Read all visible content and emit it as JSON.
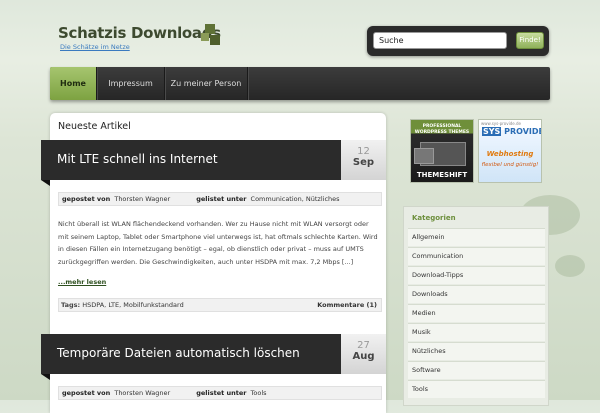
{
  "header": {
    "site_title": "Schatzis Downloads",
    "tagline": "Die Schätze im Netze",
    "search_value": "Suche",
    "search_button": "Finde!"
  },
  "nav": {
    "items": [
      "Home",
      "Impressum",
      "Zu meiner Person"
    ]
  },
  "main": {
    "heading": "Neueste Artikel",
    "posts": [
      {
        "title": "Mit LTE schnell ins Internet",
        "day": "12",
        "month": "Sep",
        "author_label": "gepostet von",
        "author": "Thorsten Wagner",
        "cat_label": "gelistet unter",
        "categories": [
          "Communication",
          "Nützliches"
        ],
        "excerpt": "Nicht überall ist WLAN flächendeckend vorhanden. Wer zu Hause nicht mit WLAN versorgt oder mit seinem Laptop, Tablet oder Smartphone viel unterwegs ist, hat oftmals schlechte Karten. Wird in diesen Fällen ein Internetzugang benötigt – egal, ob dienstlich oder privat – muss auf UMTS zurückgegriffen werden. Die Geschwindigkeiten, auch unter HSDPA mit max. 7,2 Mbps [...]",
        "more": "...mehr lesen",
        "tags_label": "Tags:",
        "tags": [
          "HSDPA",
          "LTE",
          "Mobilfunkstandard"
        ],
        "comments": "Kommentare (1)"
      },
      {
        "title": "Temporäre Dateien automatisch löschen",
        "day": "27",
        "month": "Aug",
        "author_label": "gepostet von",
        "author": "Thorsten Wagner",
        "cat_label": "gelistet unter",
        "categories": [
          "Tools"
        ]
      }
    ]
  },
  "sidebar": {
    "ads": {
      "themeshift_top": "PROFESSIONAL WORDPRESS THEMES",
      "themeshift_brand": "THEMESHIFT",
      "sys_url": "www.sys-provide.de",
      "sys_brand_a": "SYS",
      "sys_brand_b": "PROVIDE",
      "sys_headline": "Webhosting",
      "sys_slogan": "flexibel und günstig!"
    },
    "categories_heading": "Kategorien",
    "categories": [
      "Allgemein",
      "Communication",
      "Download-Tipps",
      "Downloads",
      "Medien",
      "Musik",
      "Nützliches",
      "Software",
      "Tools"
    ]
  },
  "colors": {
    "accent_green": "#8fb15a",
    "nav_dark": "#2b2b2b"
  }
}
